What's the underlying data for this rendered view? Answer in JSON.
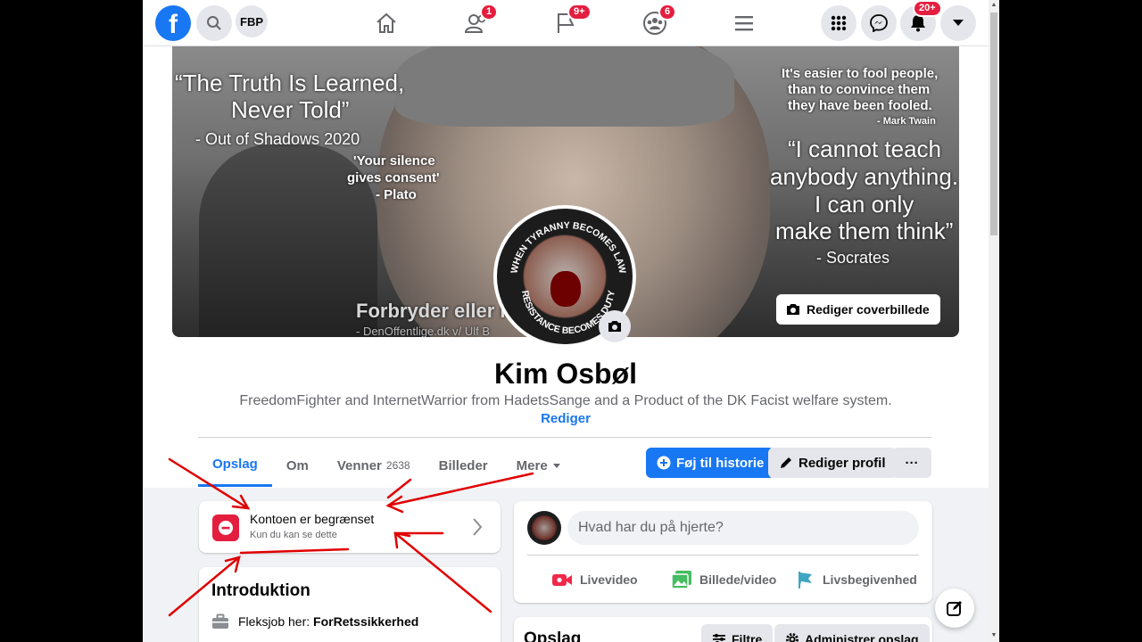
{
  "topbar": {
    "shortcut_label": "FBP",
    "badges": {
      "friends": "1",
      "pages": "9+",
      "groups": "6",
      "notifications": "20+"
    }
  },
  "cover": {
    "quote1_line1": "“The Truth Is Learned,",
    "quote1_line2": "Never Told”",
    "quote1_source": "- Out of Shadows 2020",
    "quote2_line1": "'Your silence",
    "quote2_line2": "gives consent'",
    "quote2_source": "- Plato",
    "quote3_line1": "It's easier to fool people,",
    "quote3_line2": "than to convince them",
    "quote3_line3": "they have been fooled.",
    "quote3_source": "- Mark Twain",
    "quote4_line1": "“I cannot teach",
    "quote4_line2": "anybody anything.",
    "quote4_line3": "I can only",
    "quote4_line4": "make them think”",
    "quote4_source": "- Socrates",
    "banner_text": "Forbryder eller Fri",
    "banner_sub": "- DenOffentlige.dk v/ Ulf B",
    "edit_label": "Rediger coverbillede"
  },
  "avatar": {
    "ring_top": "WHEN TYRANNY BECOMES LAW",
    "ring_bottom": "RESISTANCE BECOMES DUTY"
  },
  "profile": {
    "name": "Kim Osbøl",
    "bio": "FreedomFighter and InternetWarrior from HadetsSange and a Product of the DK Facist welfare system.",
    "edit_bio": "Rediger"
  },
  "tabs": [
    {
      "label": "Opslag"
    },
    {
      "label": "Om"
    },
    {
      "label": "Venner",
      "count": "2638"
    },
    {
      "label": "Billeder"
    },
    {
      "label": "Mere"
    }
  ],
  "actions": {
    "add_story": "Føj til historie",
    "edit_profile": "Rediger profil",
    "more": "···"
  },
  "restricted": {
    "title": "Kontoen er begrænset",
    "subtitle": "Kun du kan se dette"
  },
  "intro": {
    "title": "Introduktion",
    "job_prefix": "Fleksjob her: ",
    "job_place": "ForRetssikkerhed"
  },
  "composer": {
    "placeholder": "Hvad har du på hjerte?",
    "live": "Livevideo",
    "photo": "Billede/video",
    "life_event": "Livsbegivenhed"
  },
  "posts": {
    "title": "Opslag",
    "filter": "Filtre",
    "manage": "Administrer opslag"
  },
  "colors": {
    "brand": "#1877f2",
    "badge": "#e41e3f",
    "annotation": "#e00000"
  }
}
